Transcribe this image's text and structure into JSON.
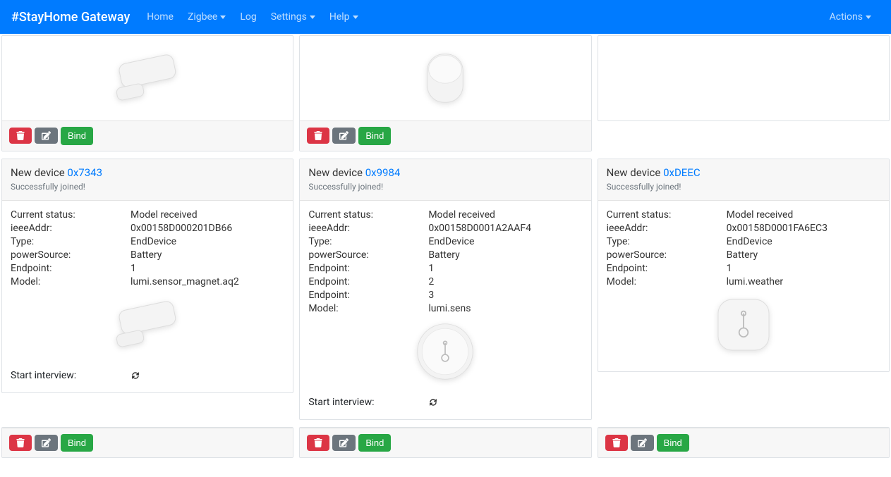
{
  "navbar": {
    "brand": "#StayHome Gateway",
    "items": [
      "Home",
      "Zigbee",
      "Log",
      "Settings",
      "Help"
    ],
    "dropdownFlags": [
      false,
      true,
      false,
      true,
      true
    ],
    "right": "Actions"
  },
  "labels": {
    "bind": "Bind",
    "newDevice": "New device",
    "joined": "Successfully joined!",
    "currentStatus": "Current status:",
    "ieeeAddr": "ieeeAddr:",
    "type": "Type:",
    "powerSource": "powerSource:",
    "endpoint": "Endpoint:",
    "model": "Model:",
    "startInterview": "Start interview:"
  },
  "devices": [
    {
      "addr": "0x7343",
      "status": "Model received",
      "ieee": "0x00158D000201DB66",
      "type": "EndDevice",
      "power": "Battery",
      "endpoints": [
        "1"
      ],
      "model": "lumi.sensor_magnet.aq2",
      "drawing": "contact",
      "showInterview": true
    },
    {
      "addr": "0x9984",
      "status": "Model received",
      "ieee": "0x00158D0001A2AAF4",
      "type": "EndDevice",
      "power": "Battery",
      "endpoints": [
        "1",
        "2",
        "3"
      ],
      "model": "lumi.sens",
      "drawing": "temp-round",
      "showInterview": true
    },
    {
      "addr": "0xDEEC",
      "status": "Model received",
      "ieee": "0x00158D0001FA6EC3",
      "type": "EndDevice",
      "power": "Battery",
      "endpoints": [
        "1"
      ],
      "model": "lumi.weather",
      "drawing": "temp-square",
      "showInterview": false
    }
  ],
  "topRow": [
    {
      "drawing": "contact",
      "showFooter": true
    },
    {
      "drawing": "motion",
      "showFooter": true
    },
    {
      "drawing": "none",
      "showFooter": false
    }
  ]
}
